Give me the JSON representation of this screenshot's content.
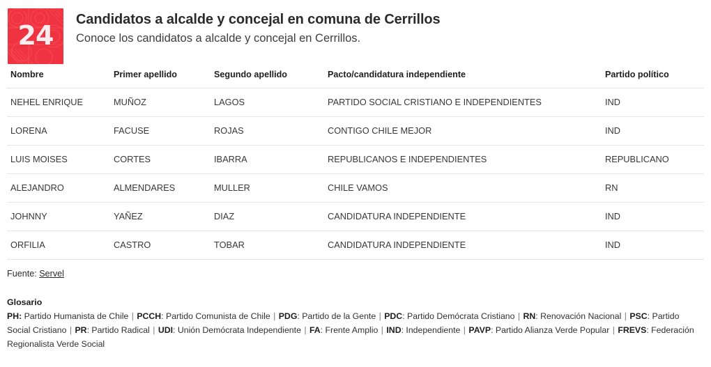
{
  "header": {
    "logo": {
      "name": "24-horas-logo",
      "text": "24",
      "bg_color": "#ef3340",
      "text_color": "#fdeced"
    },
    "title": "Candidatos a alcalde y concejal en comuna de Cerrillos",
    "subtitle": "Conoce los candidatos a alcalde y concejal en Cerrillos."
  },
  "table": {
    "columns": [
      "Nombre",
      "Primer apellido",
      "Segundo apellido",
      "Pacto/candidatura independiente",
      "Partido político"
    ],
    "rows": [
      {
        "nombre": "NEHEL ENRIQUE",
        "primer_apellido": "MUÑOZ",
        "segundo_apellido": "LAGOS",
        "pacto": "PARTIDO SOCIAL CRISTIANO E INDEPENDIENTES",
        "partido": "IND"
      },
      {
        "nombre": "LORENA",
        "primer_apellido": "FACUSE",
        "segundo_apellido": "ROJAS",
        "pacto": "CONTIGO CHILE MEJOR",
        "partido": "IND"
      },
      {
        "nombre": "LUIS MOISES",
        "primer_apellido": "CORTES",
        "segundo_apellido": "IBARRA",
        "pacto": "REPUBLICANOS E INDEPENDIENTES",
        "partido": "REPUBLICANO"
      },
      {
        "nombre": "ALEJANDRO",
        "primer_apellido": "ALMENDARES",
        "segundo_apellido": "MULLER",
        "pacto": "CHILE VAMOS",
        "partido": "RN"
      },
      {
        "nombre": "JOHNNY",
        "primer_apellido": "YAÑEZ",
        "segundo_apellido": "DIAZ",
        "pacto": "CANDIDATURA INDEPENDIENTE",
        "partido": "IND"
      },
      {
        "nombre": "ORFILIA",
        "primer_apellido": "CASTRO",
        "segundo_apellido": "TOBAR",
        "pacto": "CANDIDATURA INDEPENDIENTE",
        "partido": "IND"
      }
    ]
  },
  "footer": {
    "fuente_label": "Fuente:",
    "fuente_link": "Servel",
    "glosario_title": "Glosario",
    "glosario_entries": [
      {
        "abbr": "PH:",
        "desc": " Partido Humanista de Chile"
      },
      {
        "abbr": "PCCH",
        "desc": ": Partido Comunista de Chile"
      },
      {
        "abbr": "PDG",
        "desc": ": Partido de la Gente"
      },
      {
        "abbr": "PDC",
        "desc": ": Partido Demócrata Cristiano"
      },
      {
        "abbr": "RN",
        "desc": ": Renovación Nacional"
      },
      {
        "abbr": "PSC",
        "desc": ": Partido Social Cristiano"
      },
      {
        "abbr": "PR",
        "desc": ": Partido Radical"
      },
      {
        "abbr": "UDI",
        "desc": ": Unión Demócrata Independiente"
      },
      {
        "abbr": "FA",
        "desc": ": Frente Amplio"
      },
      {
        "abbr": "IND",
        "desc": ": Independiente"
      },
      {
        "abbr": "PAVP",
        "desc": ": Partido Alianza Verde Popular"
      },
      {
        "abbr": "FREVS",
        "desc": ": Federación Regionalista Verde Social"
      }
    ],
    "glosario_separator": "|"
  }
}
